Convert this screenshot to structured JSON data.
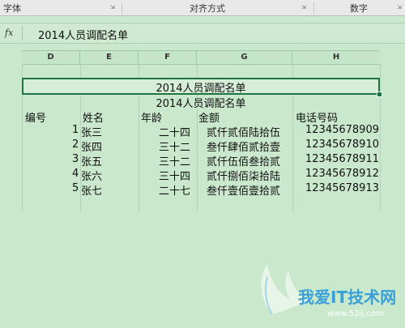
{
  "ribbon": {
    "groups": [
      {
        "label": "字体"
      },
      {
        "label": "对齐方式"
      },
      {
        "label": "数字"
      }
    ],
    "launcher_icon": "dialog-launcher-icon"
  },
  "formula_bar": {
    "fx_label": "fx",
    "value": "2014人员调配名单"
  },
  "columns": [
    "D",
    "E",
    "F",
    "G",
    "H"
  ],
  "sheet": {
    "merged_title": "2014人员调配名单",
    "title_row": "2014人员调配名单",
    "headers": [
      "编号",
      "姓名",
      "年龄",
      "金额",
      "电话号码"
    ],
    "rows": [
      [
        "1",
        "张三",
        "二十四",
        "贰仟贰佰陆拾伍",
        "12345678909"
      ],
      [
        "2",
        "张四",
        "三十二",
        "叁仟肆佰贰拾壹",
        "12345678910"
      ],
      [
        "3",
        "张五",
        "三十二",
        "贰仟伍佰叁拾贰",
        "12345678911"
      ],
      [
        "4",
        "张六",
        "三十四",
        "贰仟捌佰柒拾陆",
        "12345678912"
      ],
      [
        "5",
        "张七",
        "二十七",
        "叁仟壹佰壹拾贰",
        "12345678913"
      ]
    ]
  },
  "watermark": {
    "text": "我爱IT技术网",
    "url": "www.52ij.com",
    "color": "#3aa0d8"
  }
}
